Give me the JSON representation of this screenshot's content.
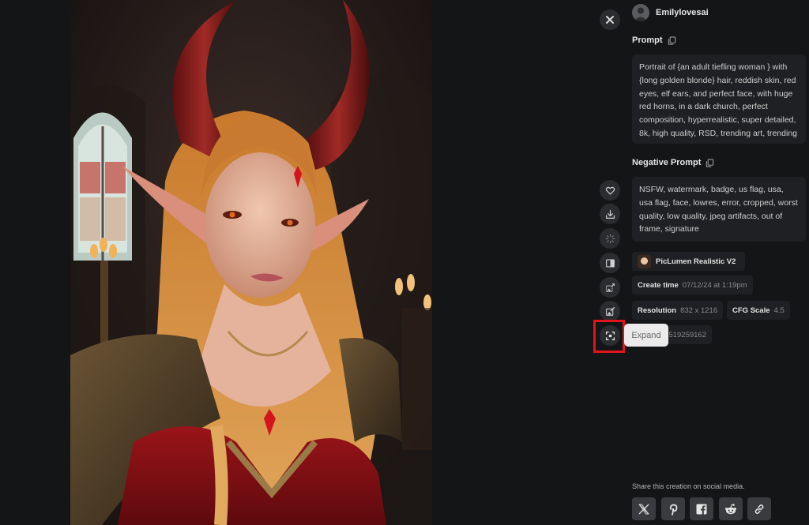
{
  "artwork": {
    "description": "AI-generated portrait of a tiefling woman with red horns, golden blonde hair and elf ears in a dark church"
  },
  "close_button": {
    "icon": "close-icon"
  },
  "user": {
    "name": "Emilylovesai",
    "avatar_icon": "user-avatar-icon"
  },
  "prompt": {
    "label": "Prompt",
    "copy_icon": "copy-icon",
    "text": "Portrait of {an adult tiefling woman } with {long golden blonde} hair, reddish skin, red eyes, elf ears, and perfect face, with huge red horns,  in a dark church, perfect composition, hyperrealistic, super detailed, 8k, high quality, RSD, trending art, trending on"
  },
  "negative_prompt": {
    "label": "Negative Prompt",
    "copy_icon": "copy-icon",
    "text": "NSFW, watermark, badge, us flag, usa, usa flag, face, lowres, error, cropped, worst quality, low quality, jpeg artifacts, out of frame, signature"
  },
  "actions": [
    {
      "name": "like",
      "icon": "heart-icon"
    },
    {
      "name": "download",
      "icon": "download-icon"
    },
    {
      "name": "loading",
      "icon": "spinner-icon"
    },
    {
      "name": "compare",
      "icon": "compare-icon"
    },
    {
      "name": "image-to-image",
      "icon": "image-edit-icon"
    },
    {
      "name": "edit-image",
      "icon": "image-pencil-icon"
    },
    {
      "name": "expand",
      "icon": "expand-icon"
    }
  ],
  "tooltip": {
    "text": "Expand"
  },
  "details": {
    "model": "PicLumen Realistic V2",
    "create_time_label": "Create time",
    "create_time_value": "07/12/24 at 1:19pm",
    "resolution_label": "Resolution",
    "resolution_value": "832 x 1216",
    "cfg_label": "CFG Scale",
    "cfg_value": "4.5",
    "seed_value_partial": "519259162"
  },
  "share": {
    "label": "Share this creation on social media.",
    "buttons": [
      {
        "name": "x",
        "icon": "x-twitter-icon"
      },
      {
        "name": "pinterest",
        "icon": "pinterest-icon"
      },
      {
        "name": "facebook",
        "icon": "facebook-icon"
      },
      {
        "name": "reddit",
        "icon": "reddit-icon"
      },
      {
        "name": "link",
        "icon": "link-icon"
      }
    ]
  }
}
